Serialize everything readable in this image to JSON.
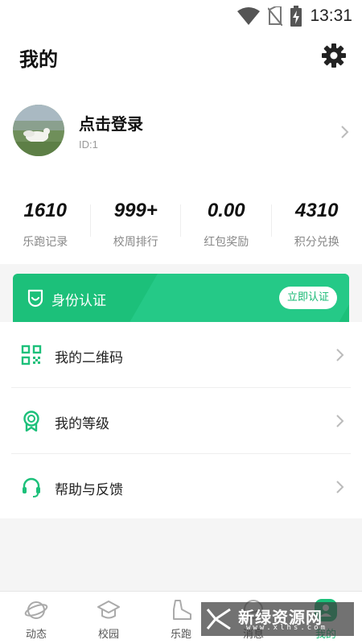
{
  "status_bar": {
    "time": "13:31"
  },
  "header": {
    "title": "我的"
  },
  "profile": {
    "login_text": "点击登录",
    "id_text": "ID:1"
  },
  "stats": [
    {
      "value": "1610",
      "label": "乐跑记录"
    },
    {
      "value": "999+",
      "label": "校周排行"
    },
    {
      "value": "0.00",
      "label": "红包奖励"
    },
    {
      "value": "4310",
      "label": "积分兑换"
    }
  ],
  "verify_banner": {
    "label": "身份认证",
    "button": "立即认证"
  },
  "menu": [
    {
      "label": "我的二维码",
      "icon": "qr-code-icon"
    },
    {
      "label": "我的等级",
      "icon": "medal-icon"
    },
    {
      "label": "帮助与反馈",
      "icon": "headset-icon"
    }
  ],
  "tabs": [
    {
      "label": "动态",
      "icon": "planet-icon"
    },
    {
      "label": "校园",
      "icon": "graduation-cap-icon"
    },
    {
      "label": "乐跑",
      "icon": "sneaker-icon"
    },
    {
      "label": "消息",
      "icon": "chat-icon"
    },
    {
      "label": "我的",
      "icon": "user-icon",
      "active": true
    }
  ],
  "watermark": {
    "name": "新绿资源网",
    "url": "www.xlhs.com"
  },
  "colors": {
    "accent": "#1cc07a",
    "text": "#222222",
    "muted": "#888888"
  }
}
